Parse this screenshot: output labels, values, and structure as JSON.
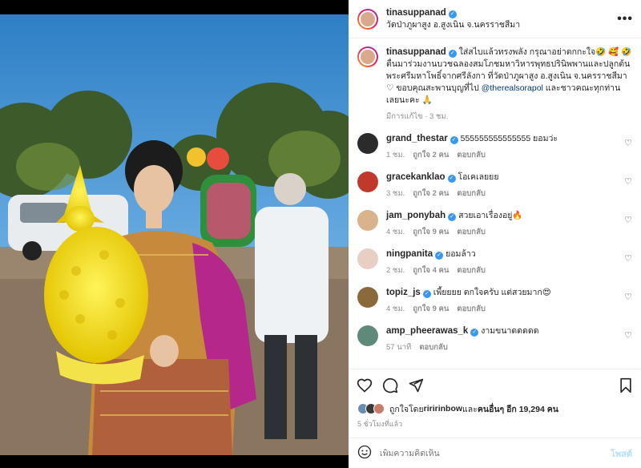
{
  "header": {
    "username": "tinasuppanad",
    "location": "วัดป่าภูผาสูง อ.สูงเนิน จ.นครราชสีมา",
    "more_label": "•••"
  },
  "caption": {
    "username": "tinasuppanad",
    "text_part1": "ใส่สไบแล้วทรงพลัง กรุณาอย่าตกกะใจ🤣 🥰 🤣 ตื่นมาร่วมงานบวชฉลองสมโภชมหาวิหารพุทธปรินิพพานและปลูกต้นพระศรีมหาโพธิ์จากศรีลังกา ที่วัดป่าภูผาสูง อ.สูงเนิน จ.นครราชสีมา ♡ ขอบคุณสะพานบุญที่ไป ",
    "mention": "@therealsorapol",
    "text_part2": " และชาวคณะทุกท่านเลยนะคะ 🙏",
    "edited": "มีการแก้ไข · 3 ชม."
  },
  "comments": [
    {
      "username": "grand_thestar",
      "verified": true,
      "text": "555555555555555 ยอมว่ะ",
      "time": "1 ชม.",
      "likes": "ถูกใจ 2 คน",
      "reply": "ตอบกลับ",
      "avatar_color": "#2b2b2b"
    },
    {
      "username": "gracekanklao",
      "verified": true,
      "text": "โอเคเลยยย",
      "time": "3 ชม.",
      "likes": "ถูกใจ 2 คน",
      "reply": "ตอบกลับ",
      "avatar_color": "#c0392b"
    },
    {
      "username": "jam_ponybah",
      "verified": true,
      "text": "สวยเอาเรื่องอยู่🔥",
      "time": "4 ชม.",
      "likes": "ถูกใจ 9 คน",
      "reply": "ตอบกลับ",
      "avatar_color": "#d9b38c"
    },
    {
      "username": "ningpanita",
      "verified": true,
      "text": "ยอมล้าว",
      "time": "2 ชม.",
      "likes": "ถูกใจ 4 คน",
      "reply": "ตอบกลับ",
      "avatar_color": "#e8cfc4"
    },
    {
      "username": "topiz_js",
      "verified": true,
      "text": "เพี้ยยยย ตกใจครับ แต่สวยมาก😍",
      "time": "4 ชม.",
      "likes": "ถูกใจ 9 คน",
      "reply": "ตอบกลับ",
      "avatar_color": "#8a6a3a"
    },
    {
      "username": "amp_pheerawas_k",
      "verified": true,
      "text": "งามขนาดดดดด",
      "time": "57 นาที",
      "likes": "",
      "reply": "ตอบกลับ",
      "avatar_color": "#5f8a7a"
    }
  ],
  "likes_line": {
    "prefix": "ถูกใจโดย ",
    "user": "riririnbow",
    "middle": " และ",
    "others": "คนอื่นๆ อีก 19,294 คน"
  },
  "time_ago": "5 ชั่วโมงที่แล้ว",
  "composer": {
    "placeholder": "เพิ่มความคิดเห็น",
    "post_label": "โพสต์"
  },
  "colors": {
    "link_blue": "#00376b",
    "verified_blue": "#3897f0",
    "post_button": "#b2dffc"
  }
}
